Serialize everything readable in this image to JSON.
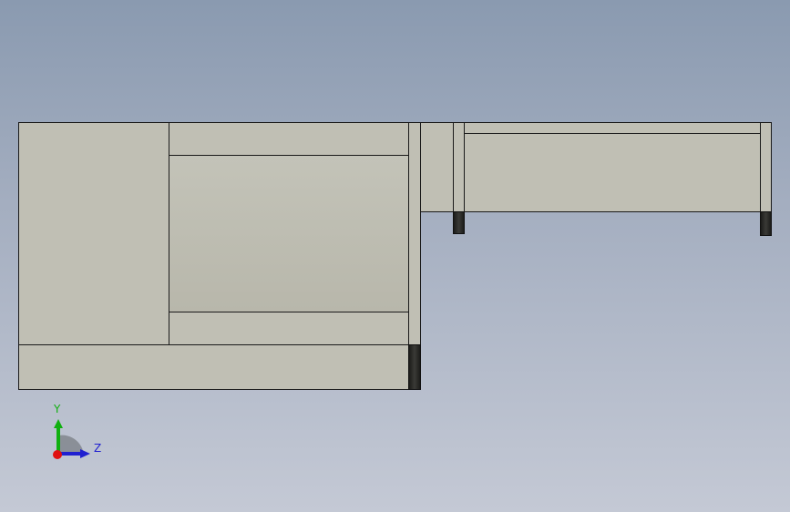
{
  "viewport": {
    "background_top": "#8a9ab0",
    "background_bottom": "#c4c9d5"
  },
  "model": {
    "face_color": "#c0bfb4",
    "edge_color": "#1a1a1a",
    "foot_color": "#2a2a28"
  },
  "triad": {
    "y_label": "Y",
    "z_label": "Z",
    "y_color": "#10b010",
    "z_color": "#2020d0",
    "x_color": "#e01010"
  }
}
